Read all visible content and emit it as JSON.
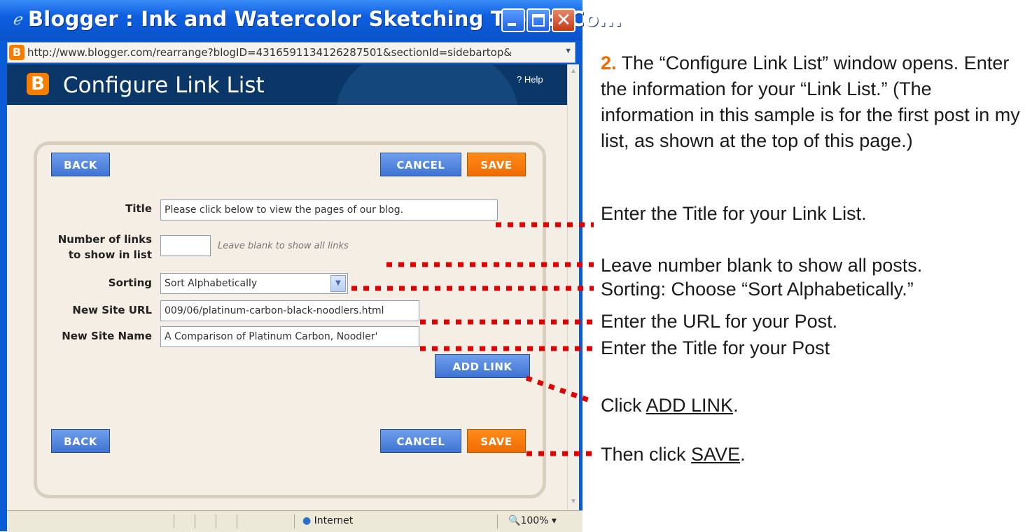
{
  "window": {
    "title": "Blogger : Ink and Watercolor Sketching Tips :: Co...",
    "address": "http://www.blogger.com/rearrange?blogID=4316591134126287501&sectionId=sidebartop&"
  },
  "header": {
    "title": "Configure Link List",
    "help": "? Help"
  },
  "form": {
    "back_label": "BACK",
    "cancel_label": "CANCEL",
    "save_label": "SAVE",
    "title_label": "Title",
    "title_value": "Please click below to view the pages of our blog.",
    "num_links_label_1": "Number of links",
    "num_links_label_2": "to show in list",
    "num_links_value": "",
    "num_links_hint": "Leave blank to show all links",
    "sorting_label": "Sorting",
    "sorting_value": "Sort Alphabetically",
    "url_label": "New Site URL",
    "url_value": "009/06/platinum-carbon-black-noodlers.html",
    "name_label": "New Site Name",
    "name_value": "A Comparison of Platinum Carbon, Noodler'",
    "add_link_label": "ADD LINK"
  },
  "statusbar": {
    "zone": "Internet",
    "zoom": "100%"
  },
  "instructions": {
    "step_number": "2.",
    "intro": " The “Configure Link List” window opens. Enter the information for your “Link List.” (The information in this sample is for the first post in my list, as shown at the top of this page.)",
    "title_note": "Enter the Title for your Link List.",
    "number_note": "Leave number blank to show all posts.",
    "sorting_note": "Sorting: Choose “Sort Alphabetically.”",
    "url_note": "Enter the URL for your Post.",
    "name_note": "Enter the Title for your Post",
    "click_prefix": "Click ",
    "click_target": "ADD LINK",
    "click_suffix": ".",
    "then_prefix": "Then click ",
    "then_target": "SAVE",
    "then_suffix": "."
  },
  "colors": {
    "accent_orange": "#ef6b00",
    "pointer_red": "#e00000",
    "blogger_navy": "#0a3768",
    "button_blue": "#3f74d4"
  }
}
